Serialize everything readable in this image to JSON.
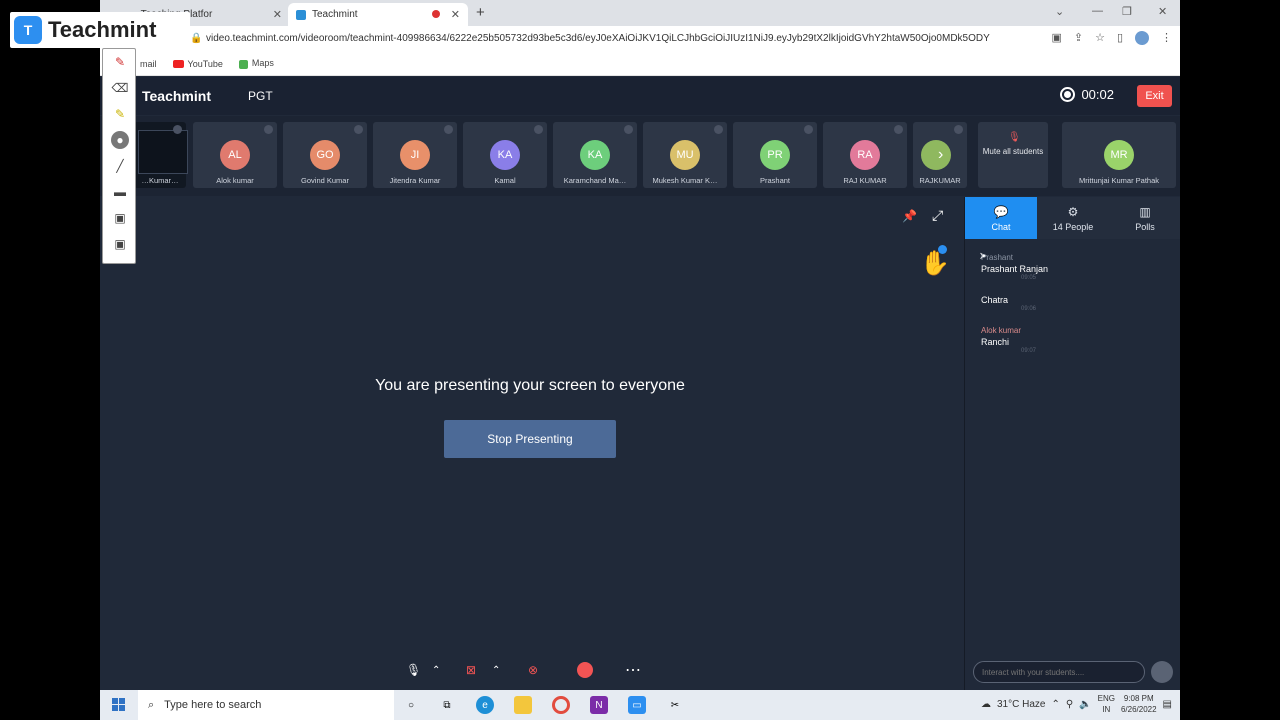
{
  "brand": {
    "name": "Teachmint",
    "mark": "T"
  },
  "browser": {
    "tab1": "… Teaching Platfor",
    "tab2": "Teachmint",
    "url": "video.teachmint.com/videoroom/teachmint-409986634/6222e25b505732d93be5c3d6/eyJ0eXAiOiJKV1QiLCJhbGciOiJIUzI1NiJ9.eyJyb29tX2lkIjoidGVhY2htaW50Ojo0MDk5ODY",
    "bookmarks": [
      "mail",
      "YouTube",
      "Maps"
    ]
  },
  "app": {
    "logo": "Teachmint",
    "class_name": "PGT",
    "timer": "00:02",
    "exit_label": "Exit"
  },
  "participants": [
    {
      "initials": "",
      "name": "…Kumar…",
      "color": "#111822",
      "screen": true
    },
    {
      "initials": "AL",
      "name": "Alok kumar",
      "color": "#e07a6e"
    },
    {
      "initials": "GO",
      "name": "Govind Kumar",
      "color": "#e58b6a"
    },
    {
      "initials": "JI",
      "name": "Jitendra Kumar",
      "color": "#e8906a"
    },
    {
      "initials": "KA",
      "name": "Kamal",
      "color": "#8a7ee8"
    },
    {
      "initials": "KA",
      "name": "Karamchand Ma…",
      "color": "#6dce7c"
    },
    {
      "initials": "MU",
      "name": "Mukesh Kumar K…",
      "color": "#d9c06a"
    },
    {
      "initials": "PR",
      "name": "Prashant",
      "color": "#7fd176"
    },
    {
      "initials": "RA",
      "name": "RAJ KUMAR",
      "color": "#e27a9a"
    },
    {
      "initials": "",
      "name": "RAJKUMAR",
      "color": "#8fb85f"
    }
  ],
  "mute_all": "Mute all students",
  "host": {
    "initials": "MR",
    "name": "Mrittunjai Kumar Pathak",
    "color": "#9ad36a"
  },
  "main": {
    "message": "You are presenting your screen to everyone",
    "stop_label": "Stop Presenting"
  },
  "panel": {
    "tabs": [
      {
        "label": "Chat",
        "icon": "💬"
      },
      {
        "label": "14 People",
        "icon": "⚙"
      },
      {
        "label": "Polls",
        "icon": "▥"
      }
    ],
    "messages": [
      {
        "from": "Prashant",
        "text": "Prashant Ranjan",
        "time": "09:05"
      },
      {
        "from": "",
        "text": "Chatra",
        "time": "09:06"
      },
      {
        "from": "Alok kumar",
        "text": "Ranchi",
        "time": "09:07"
      }
    ],
    "input_placeholder": "Interact with your students...."
  },
  "taskbar": {
    "search_placeholder": "Type here to search",
    "weather": "31°C Haze",
    "lang": "ENG",
    "region": "IN",
    "time": "9:08 PM",
    "date": "6/26/2022"
  }
}
